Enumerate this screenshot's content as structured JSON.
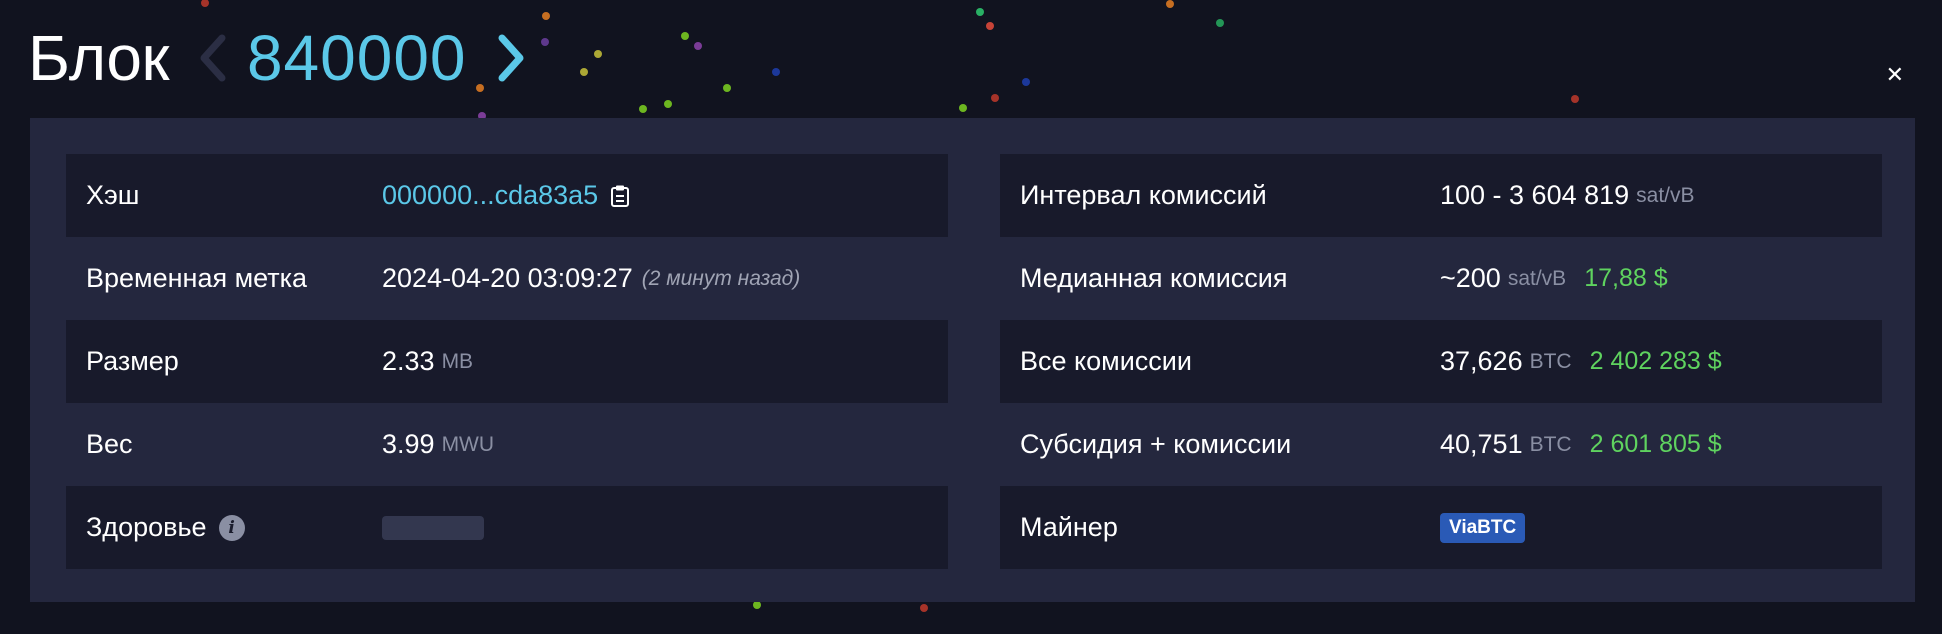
{
  "header": {
    "title": "Блок",
    "block_height": "840000"
  },
  "block": {
    "hash_label": "Хэш",
    "hash_value": "000000...cda83a5",
    "timestamp_label": "Временная метка",
    "timestamp_value": "2024-04-20 03:09:27",
    "timestamp_ago": "(2 минут назад)",
    "size_label": "Размер",
    "size_value": "2.33",
    "size_unit": "MB",
    "weight_label": "Вес",
    "weight_value": "3.99",
    "weight_unit": "MWU",
    "health_label": "Здоровье",
    "health_info_icon": "i"
  },
  "fees": {
    "range_label": "Интервал комиссий",
    "range_value": "100 - 3 604 819",
    "range_unit": "sat/vB",
    "median_label": "Медианная комиссия",
    "median_value": "~200",
    "median_unit": "sat/vB",
    "median_usd": "17,88 $",
    "total_label": "Все комиссии",
    "total_value": "37,626",
    "total_unit": "BTC",
    "total_usd": "2 402 283 $",
    "subsidy_label": "Субсидия + комиссии",
    "subsidy_value": "40,751",
    "subsidy_unit": "BTC",
    "subsidy_usd": "2 601 805 $",
    "miner_label": "Майнер",
    "miner_value": "ViaBTC"
  },
  "colors": {
    "background": "#11131f",
    "panel": "#24273e",
    "row_dark": "#181a2b",
    "accent": "#5bc8e8",
    "usd_green": "#5fd35f",
    "miner_badge": "#2a5ab6"
  },
  "icons": {
    "prev": "chevron-left-icon",
    "next": "chevron-right-icon",
    "close": "close-icon",
    "copy": "clipboard-icon",
    "info": "info-icon"
  }
}
